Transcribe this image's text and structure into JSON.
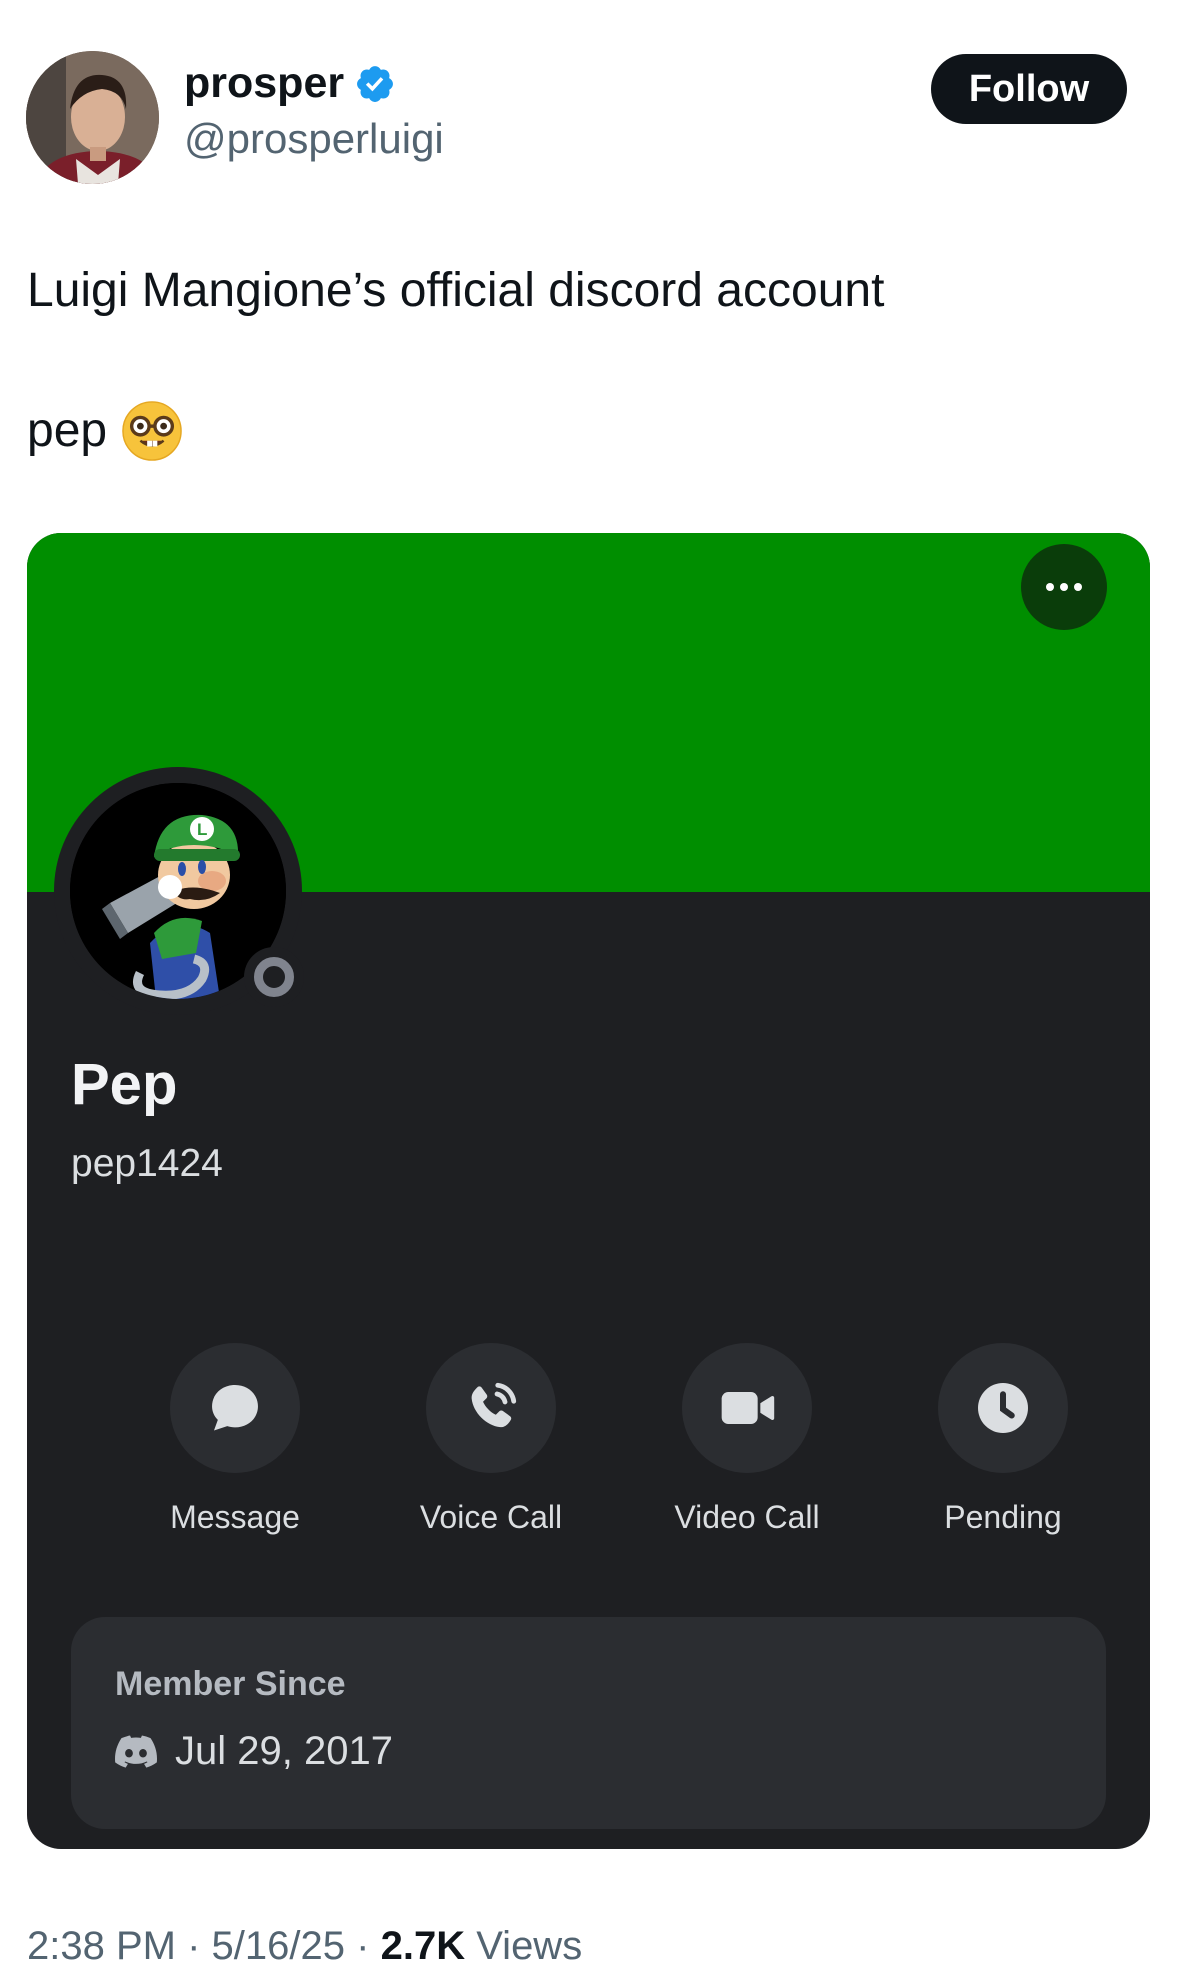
{
  "tweet": {
    "author": {
      "name": "prosper",
      "handle": "@prosperluigi",
      "verified": true
    },
    "follow_label": "Follow",
    "text_line1": "Luigi Mangione’s official discord account",
    "text_line2": "pep",
    "emoji": "nerd-face-emoji",
    "meta": {
      "time": "2:38 PM",
      "date": "5/16/25",
      "views_count": "2.7K",
      "views_label": "Views",
      "separator": "·"
    }
  },
  "discord_profile": {
    "banner_color": "#008e00",
    "display_name": "Pep",
    "username": "pep1424",
    "status": "offline",
    "actions": [
      {
        "label": "Message",
        "icon": "chat-bubble-icon"
      },
      {
        "label": "Voice Call",
        "icon": "phone-call-icon"
      },
      {
        "label": "Video Call",
        "icon": "video-camera-icon"
      },
      {
        "label": "Pending",
        "icon": "clock-icon"
      }
    ],
    "member_since": {
      "title": "Member Since",
      "date": "Jul 29, 2017",
      "icon": "discord-logo-icon"
    }
  },
  "colors": {
    "card_bg": "#1e1f22",
    "panel_bg": "#2b2d31",
    "follow_bg": "#0f1419",
    "secondary_text": "#536471",
    "verified_blue": "#1d9bf0"
  }
}
